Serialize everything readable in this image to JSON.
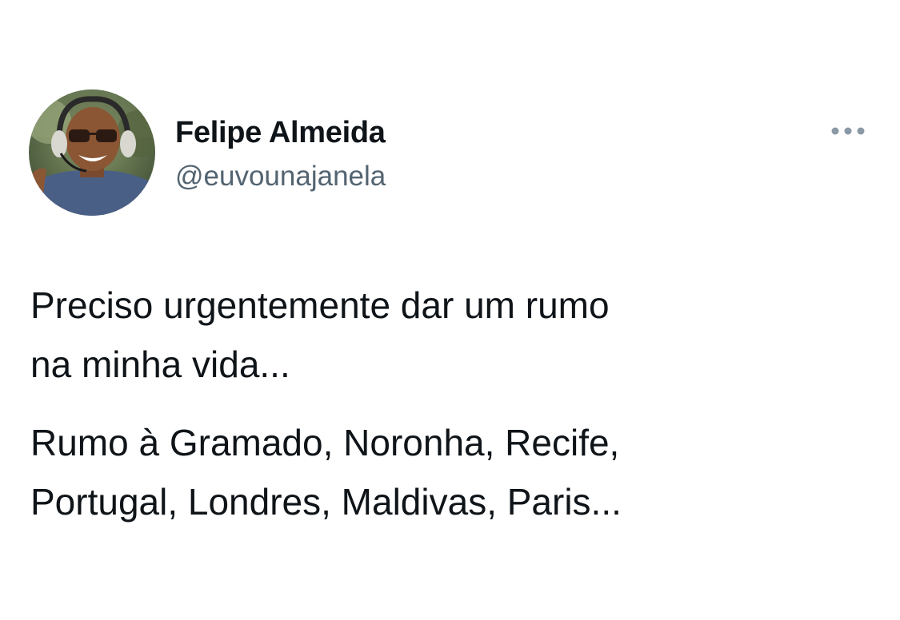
{
  "author": {
    "display_name": "Felipe Almeida",
    "handle": "@euvounajanela",
    "avatar_icon": "profile-photo"
  },
  "more_icon": "ellipsis-icon",
  "tweet": {
    "paragraph1_line1": "Preciso urgentemente dar um rumo",
    "paragraph1_line2": "na minha vida...",
    "paragraph2_line1": "Rumo à Gramado, Noronha, Recife,",
    "paragraph2_line2": "Portugal, Londres, Maldivas, Paris..."
  },
  "colors": {
    "text": "#0f1419",
    "secondary": "#536471",
    "more_dots": "#8b98a5"
  }
}
